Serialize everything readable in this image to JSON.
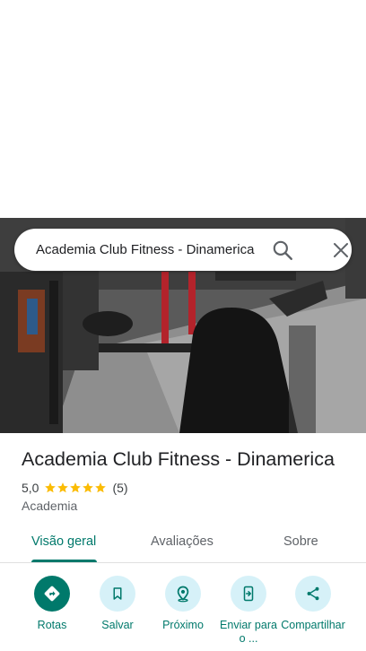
{
  "search": {
    "query": "Academia Club Fitness - Dinamerica"
  },
  "place": {
    "title": "Academia Club Fitness - Dinamerica",
    "rating": "5,0",
    "stars": 5,
    "review_count": "(5)",
    "category": "Academia"
  },
  "tabs": [
    {
      "label": "Visão geral",
      "active": true
    },
    {
      "label": "Avaliações",
      "active": false
    },
    {
      "label": "Sobre",
      "active": false
    }
  ],
  "actions": [
    {
      "label": "Rotas",
      "icon": "directions-icon"
    },
    {
      "label": "Salvar",
      "icon": "bookmark-icon"
    },
    {
      "label": "Próximo",
      "icon": "nearby-icon"
    },
    {
      "label": "Enviar para o ...",
      "icon": "send-to-phone-icon"
    },
    {
      "label": "Compartilhar",
      "icon": "share-icon"
    }
  ],
  "colors": {
    "accent": "#00796b",
    "action_bg": "#d6f1f8",
    "star": "#fbbc04"
  }
}
